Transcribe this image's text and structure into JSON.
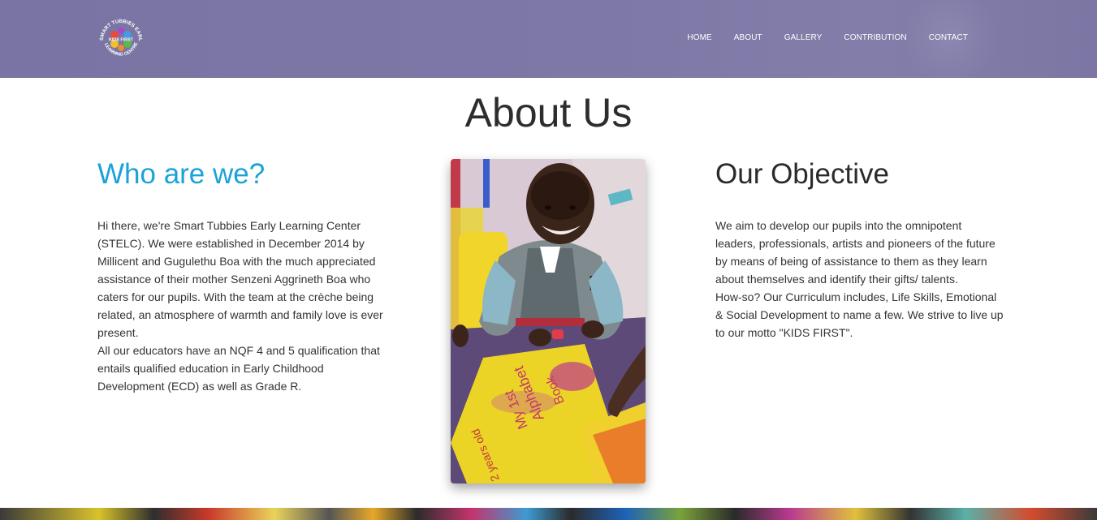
{
  "nav": {
    "logo_text_top": "SMART TUBBIES EARLY",
    "logo_text_bottom": "LEARNING CENTRE",
    "logo_center": "KIDS FIRST",
    "links": [
      "HOME",
      "ABOUT",
      "GALLERY",
      "CONTRIBUTION",
      "CONTACT"
    ]
  },
  "page": {
    "title": "About Us"
  },
  "who": {
    "heading": "Who are we?",
    "para1": "Hi there, we're Smart Tubbies Early Learning Center (STELC). We were established in December 2014 by Millicent and Gugulethu Boa with the much appreciated assistance of their mother Senzeni Aggrineth Boa who caters for our pupils. With the team at the crèche being related, an atmosphere of warmth and family love is ever present.",
    "para2": "All our educators have an NQF 4 and 5 qualification that entails qualified education in Early Childhood Development (ECD) as well as Grade R."
  },
  "objective": {
    "heading": "Our Objective",
    "para1": "We aim to develop our pupils into the omnipotent leaders, professionals, artists and pioneers of the future by means of being of assistance to them as they learn about themselves and identify their gifts/ talents.",
    "para2": "How-so? Our Curriculum includes, Life Skills, Emotional & Social Development to name a few. We strive to live up to our motto \"KIDS FIRST\"."
  },
  "photo": {
    "paper_lines": [
      "My 1st",
      "Alphabet",
      "Book",
      "2 years old"
    ]
  },
  "colors": {
    "navbar": "#7a74a4",
    "accent_heading": "#1aa3d9",
    "text": "#333333"
  }
}
